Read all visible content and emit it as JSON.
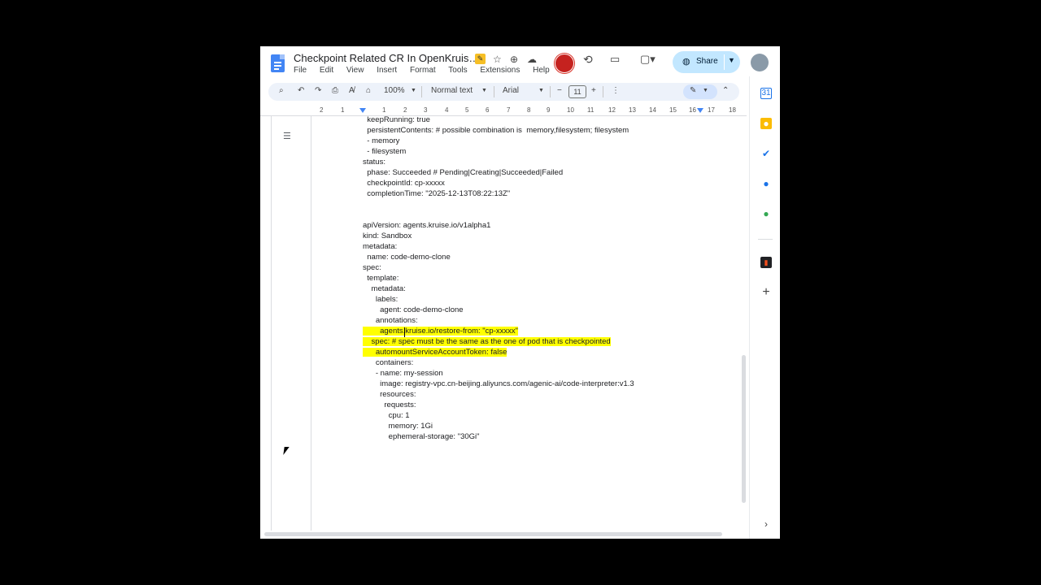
{
  "doc": {
    "title": "Checkpoint Related CR In OpenKruis…",
    "menu": [
      "File",
      "Edit",
      "View",
      "Insert",
      "Format",
      "Tools",
      "Extensions",
      "Help"
    ]
  },
  "share": {
    "label": "Share"
  },
  "toolbar": {
    "zoom": "100%",
    "style": "Normal text",
    "font": "Arial",
    "font_size": "11"
  },
  "ruler": {
    "numbers": [
      "2",
      "1",
      "1",
      "2",
      "3",
      "4",
      "5",
      "6",
      "7",
      "8",
      "9",
      "10",
      "11",
      "12",
      "13",
      "14",
      "15",
      "16",
      "17",
      "18"
    ]
  },
  "document_lines": [
    "  keepRunning: true",
    "  persistentContents: # possible combination is  memory,filesystem; filesystem",
    "  - memory",
    "  - filesystem",
    "status:",
    "  phase: Succeeded # Pending|Creating|Succeeded|Failed",
    "  checkpointId: cp-xxxxx",
    "  completionTime: \"2025-12-13T08:22:13Z\"",
    "",
    "",
    "apiVersion: agents.kruise.io/v1alpha1",
    "kind: Sandbox",
    "metadata:",
    "  name: code-demo-clone",
    "spec:",
    "  template:",
    "    metadata:",
    "      labels:",
    "        agent: code-demo-clone",
    "      annotations:",
    "        agents.kruise.io/restore-from: \"cp-xxxxx\"",
    "    spec: # spec must be the same as the one of pod that is checkpointed",
    "      automountServiceAccountToken: false",
    "      containers:",
    "      - name: my-session",
    "        image: registry-vpc.cn-beijing.aliyuncs.com/agenic-ai/code-interpreter:v1.3",
    "        resources:",
    "          requests:",
    "            cpu: 1",
    "            memory: 1Gi",
    "            ephemeral-storage: \"30Gi\""
  ],
  "highlighted_lines": [
    20,
    21,
    22
  ],
  "highlight_color": "#ffff00",
  "icons": {
    "side_panel": [
      "calendar-icon",
      "keep-icon",
      "tasks-icon",
      "contacts-icon",
      "maps-icon",
      "addon-icon",
      "add-icon",
      "expand-icon"
    ]
  }
}
